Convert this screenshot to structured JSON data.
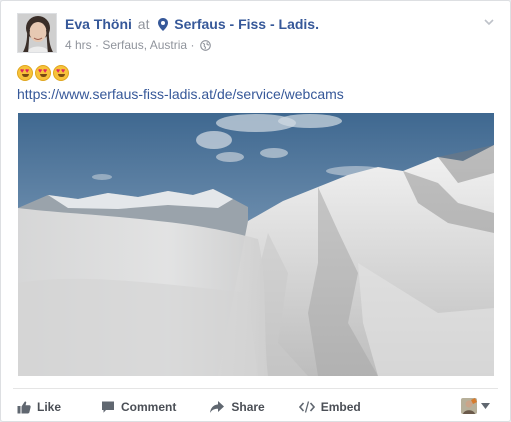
{
  "post": {
    "author": "Eva Thöni",
    "at_word": "at",
    "place": "Serfaus - Fiss - Ladis.",
    "time": "4 hrs",
    "location": "Serfaus, Austria",
    "separator": "·",
    "emoji": [
      "heart-eyes-emoji",
      "heart-eyes-emoji",
      "heart-eyes-emoji"
    ],
    "link": "https://www.serfaus-fiss-ladis.at/de/service/webcams",
    "photo_description_icon": "mountain-webcam-photo"
  },
  "actions": {
    "like": "Like",
    "comment": "Comment",
    "share": "Share",
    "embed": "Embed"
  },
  "colors": {
    "link": "#365899",
    "meta": "#90949c",
    "action_text": "#4b4f56"
  }
}
